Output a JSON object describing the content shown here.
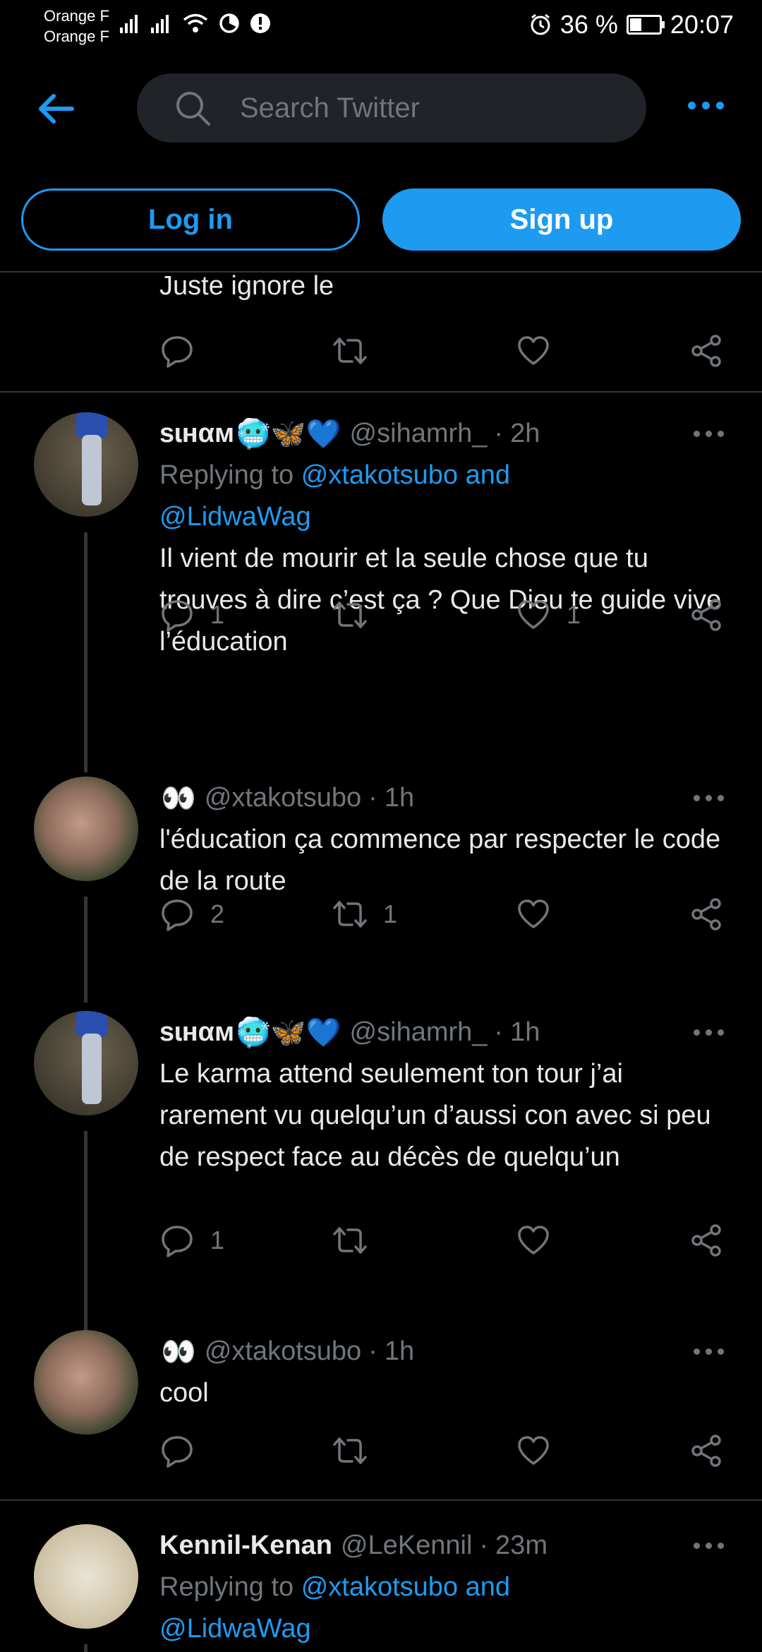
{
  "status_bar": {
    "carrier_1": "Orange F",
    "carrier_2": "Orange F",
    "battery_text": "36 %",
    "battery_level": 0.36,
    "time": "20:07"
  },
  "header": {
    "search_placeholder": "Search Twitter",
    "login_label": "Log in",
    "signup_label": "Sign up"
  },
  "accent_color": "#1d9bf0",
  "feed": {
    "partial_text": "Juste ignore le",
    "tweets": [
      {
        "display_name": "sɩнαм",
        "emojis": "🥶🦋💙",
        "handle": "@sihamrh_",
        "sep": "·",
        "time": "2h",
        "reply_prefix": "Replying to",
        "reply_mention_1": "@xtakotsubo",
        "reply_and": "and",
        "reply_mention_2": "@LidwaWag",
        "text": "Il vient de mourir et la seule chose que tu trouves à dire c’est ça ? Que Dieu te guide vive l’éducation",
        "replies": "1",
        "retweets": "",
        "likes": "1"
      },
      {
        "display_name": "",
        "emojis": "👀",
        "handle": "@xtakotsubo",
        "sep": "·",
        "time": "1h",
        "text": "l'éducation ça commence par respecter le code de la route",
        "replies": "2",
        "retweets": "1",
        "likes": ""
      },
      {
        "display_name": "sɩнαм",
        "emojis": "🥶🦋💙",
        "handle": "@sihamrh_",
        "sep": "·",
        "time": "1h",
        "text": "Le karma attend seulement ton tour j’ai rarement vu quelqu’un d’aussi con avec si peu de respect face au décès de quelqu’un",
        "replies": "1",
        "retweets": "",
        "likes": ""
      },
      {
        "display_name": "",
        "emojis": "👀",
        "handle": "@xtakotsubo",
        "sep": "·",
        "time": "1h",
        "text": "cool",
        "replies": "",
        "retweets": "",
        "likes": ""
      },
      {
        "display_name": "Kennil-Kenan",
        "emojis": "",
        "handle": "@LeKennil",
        "sep": "·",
        "time": "23m",
        "reply_prefix": "Replying to",
        "reply_mention_1": "@xtakotsubo",
        "reply_and": "and",
        "reply_mention_2": "@LidwaWag"
      }
    ]
  }
}
